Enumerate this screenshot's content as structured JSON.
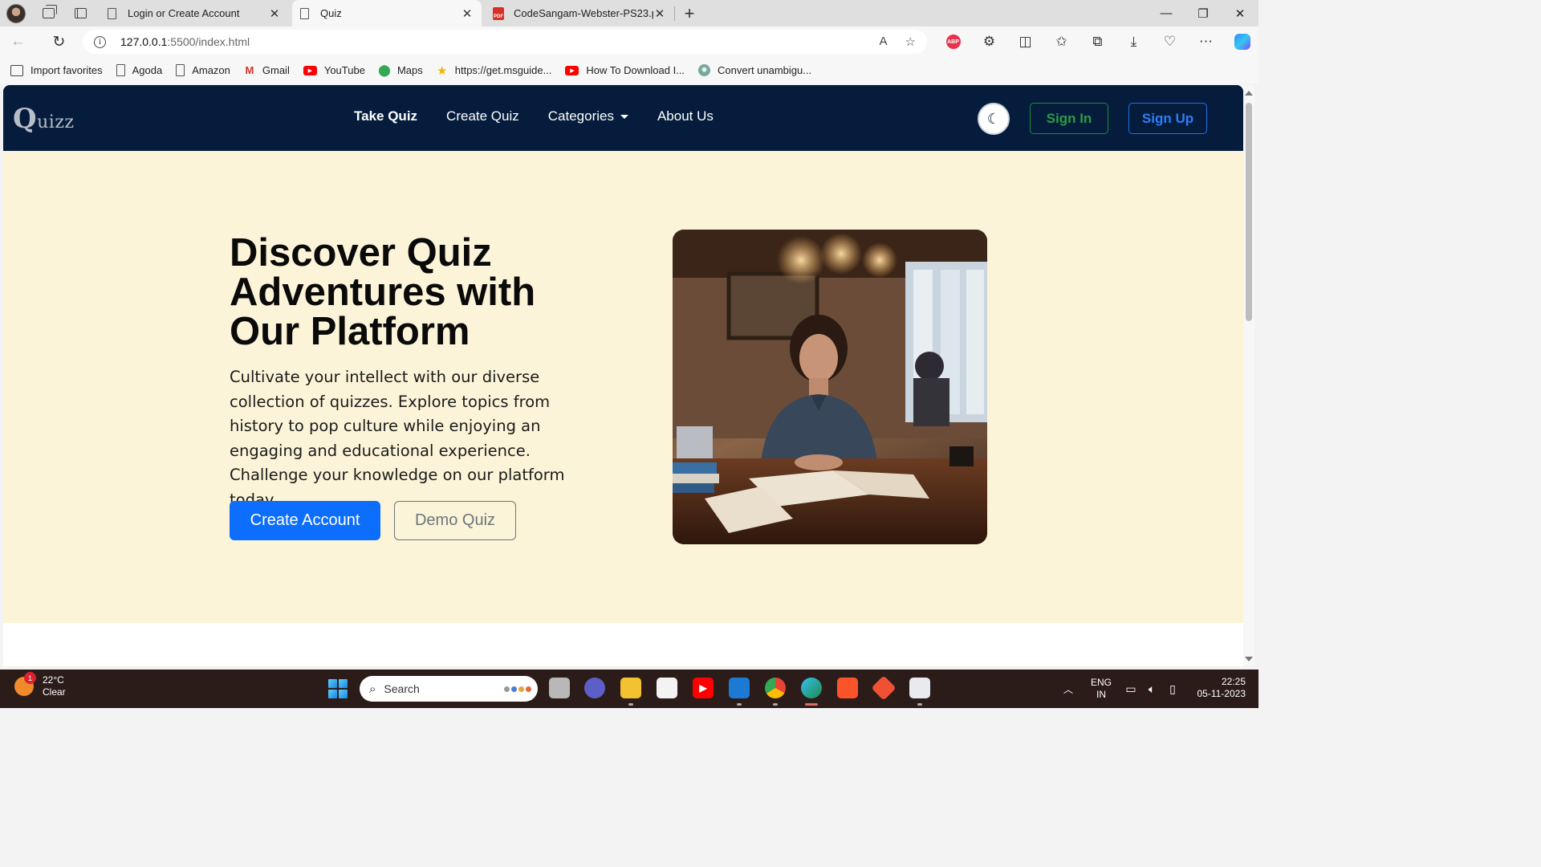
{
  "browser": {
    "tabs": [
      {
        "label": "Login or Create Account",
        "active": false,
        "icon": "page-icon"
      },
      {
        "label": "Quiz",
        "active": true,
        "icon": "page-icon"
      },
      {
        "label": "CodeSangam-Webster-PS23.pdf",
        "active": false,
        "icon": "pdf-icon"
      }
    ],
    "pdf_icon_text": "PDF",
    "url_host": "127.0.0.1",
    "url_path": ":5500/index.html",
    "favorites": [
      {
        "label": "Import favorites",
        "icon": "import-icon"
      },
      {
        "label": "Agoda",
        "icon": "page-icon"
      },
      {
        "label": "Amazon",
        "icon": "page-icon"
      },
      {
        "label": "Gmail",
        "icon": "gmail-icon"
      },
      {
        "label": "YouTube",
        "icon": "youtube-icon"
      },
      {
        "label": "Maps",
        "icon": "maps-icon"
      },
      {
        "label": "https://get.msguide...",
        "icon": "star-icon"
      },
      {
        "label": "How To Download I...",
        "icon": "youtube-icon"
      },
      {
        "label": "Convert unambigu...",
        "icon": "chatgpt-icon"
      }
    ]
  },
  "site": {
    "brand_initial": "Q",
    "brand_rest": "uizz",
    "nav": {
      "take_quiz": "Take Quiz",
      "create_quiz": "Create Quiz",
      "categories": "Categories",
      "about": "About Us"
    },
    "sign_in": "Sign In",
    "sign_up": "Sign Up",
    "hero": {
      "title": "Discover Quiz Adventures with Our Platform",
      "text": "Cultivate your intellect with our diverse collection of quizzes. Explore topics from history to pop culture while enjoying an engaging and educational experience. Challenge your knowledge on our platform today.",
      "create_account": "Create Account",
      "demo_quiz": "Demo Quiz"
    },
    "colors": {
      "navbar": "#051c3c",
      "hero_bg": "#fcf4d8",
      "primary": "#0d6efd",
      "success": "#2a9e45"
    }
  },
  "taskbar": {
    "weather_badge": "1",
    "temperature": "22°C",
    "condition": "Clear",
    "search_placeholder": "Search",
    "lang_line1": "ENG",
    "lang_line2": "IN",
    "time": "22:25",
    "date": "05-11-2023"
  }
}
